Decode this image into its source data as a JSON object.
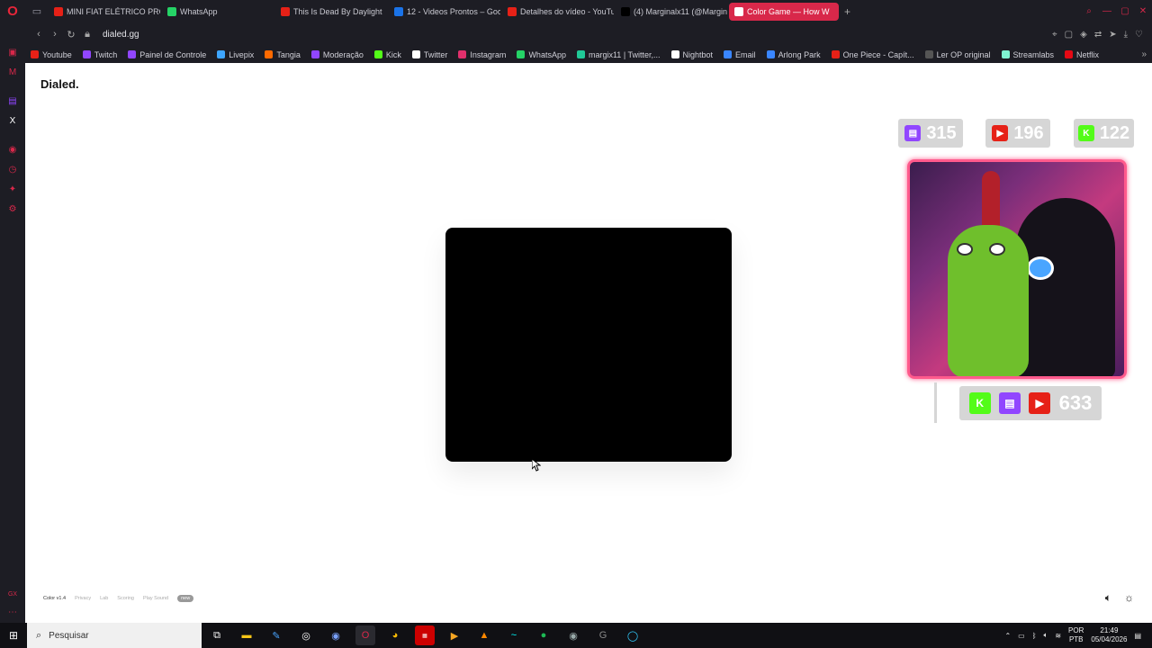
{
  "browser": {
    "tabs": [
      {
        "title": "MINI FIAT ELÉTRICO PROI",
        "color": "#e62117"
      },
      {
        "title": "WhatsApp",
        "color": "#25d366"
      },
      {
        "title": "This Is Dead By Daylight",
        "color": "#e62117"
      },
      {
        "title": "12 - Videos Prontos – Goo",
        "color": "#1a73e8"
      },
      {
        "title": "Detalhes do vídeo - YouTu",
        "color": "#e62117"
      },
      {
        "title": "(4) Marginalx11 (@Margin",
        "color": "#000000"
      },
      {
        "title": "Color Game — How W",
        "color": "#ffffff",
        "active": true
      }
    ],
    "url": "dialed.gg",
    "bookmarks": [
      {
        "label": "Youtube",
        "color": "#e62117"
      },
      {
        "label": "Twitch",
        "color": "#9146ff"
      },
      {
        "label": "Painel de Controle",
        "color": "#9146ff"
      },
      {
        "label": "Livepix",
        "color": "#3ea6ff"
      },
      {
        "label": "Tangia",
        "color": "#ff6a00"
      },
      {
        "label": "Moderação",
        "color": "#9146ff"
      },
      {
        "label": "Kick",
        "color": "#53fc18"
      },
      {
        "label": "Twitter",
        "color": "#ffffff"
      },
      {
        "label": "Instagram",
        "color": "#e1306c"
      },
      {
        "label": "WhatsApp",
        "color": "#25d366"
      },
      {
        "label": "margix11 | Twitter,...",
        "color": "#20c997"
      },
      {
        "label": "Nightbot",
        "color": "#ffffff"
      },
      {
        "label": "Email",
        "color": "#3a86ff"
      },
      {
        "label": "Arlong Park",
        "color": "#3a86ff"
      },
      {
        "label": "One Piece - Capít...",
        "color": "#e62117"
      },
      {
        "label": "Ler OP original",
        "color": "#555555"
      },
      {
        "label": "Streamlabs",
        "color": "#80f5d2"
      },
      {
        "label": "Netflix",
        "color": "#e50914"
      }
    ]
  },
  "page": {
    "logo": "Dialed.",
    "footer": {
      "version": "Color v1.4",
      "privacy": "Privacy",
      "lab": "Lab",
      "scoring": "Scoring",
      "play_sound": "Play Sound",
      "new_badge": "new"
    }
  },
  "overlay": {
    "twitch_count": "315",
    "youtube_count": "196",
    "kick_count": "122",
    "total_count": "633"
  },
  "taskbar": {
    "search_placeholder": "Pesquisar",
    "lang": "POR",
    "lang2": "PTB",
    "time": "21:49",
    "date": "05/04/2026"
  }
}
